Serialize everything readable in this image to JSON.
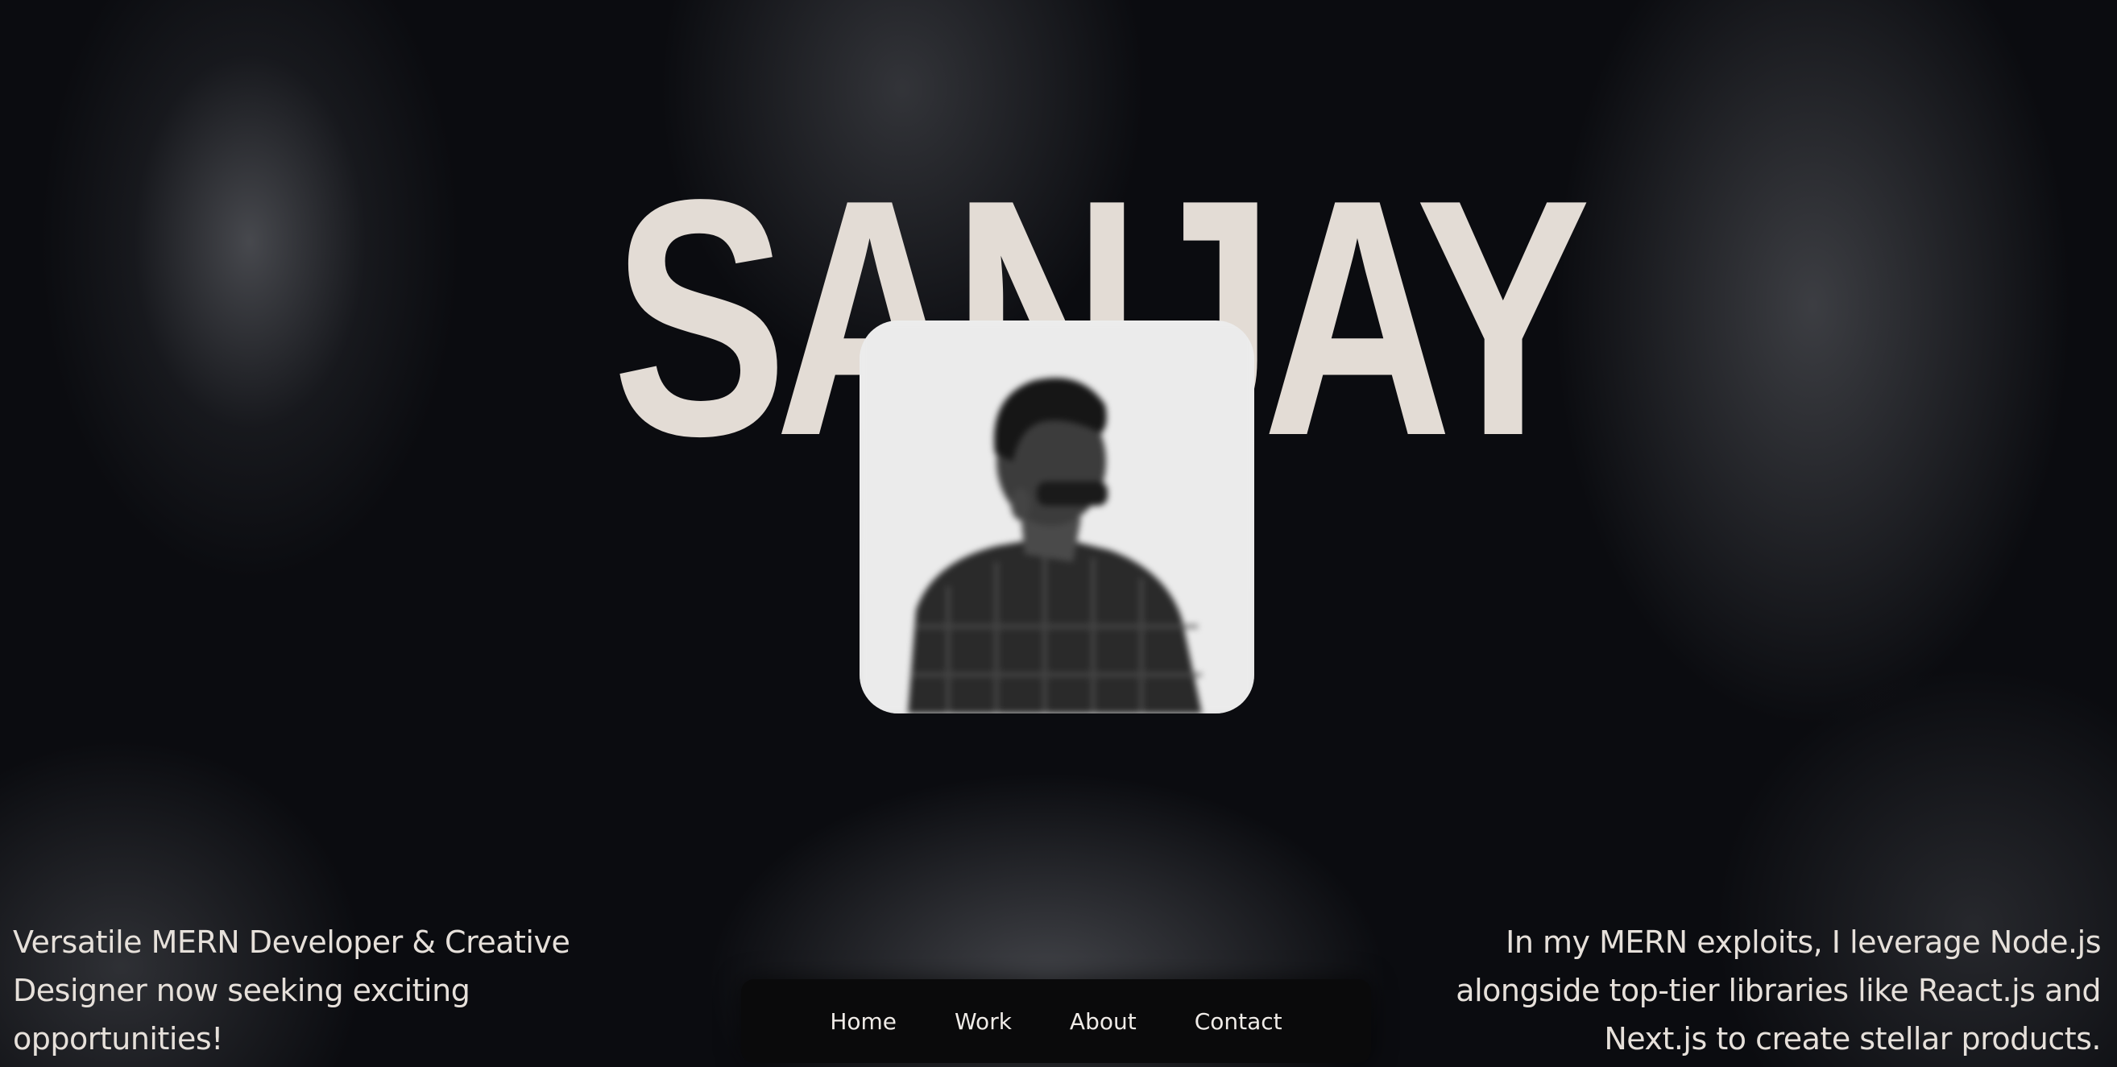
{
  "hero": {
    "name": "SANJAY",
    "portrait_alt": "portrait-photo"
  },
  "left_text": {
    "tagline": "Versatile MERN Developer & Creative Designer now seeking exciting opportunities!"
  },
  "right_text": {
    "bio": "In my MERN exploits, I leverage Node.js alongside top-tier libraries like React.js and Next.js to create stellar products."
  },
  "nav": {
    "items": [
      {
        "label": "Home"
      },
      {
        "label": "Work"
      },
      {
        "label": "About"
      },
      {
        "label": "Contact"
      }
    ]
  },
  "colors": {
    "background": "#0b0c10",
    "headline": "#e3dcd5",
    "text": "#e6e0da",
    "nav_bg": "#0a0a0b"
  }
}
